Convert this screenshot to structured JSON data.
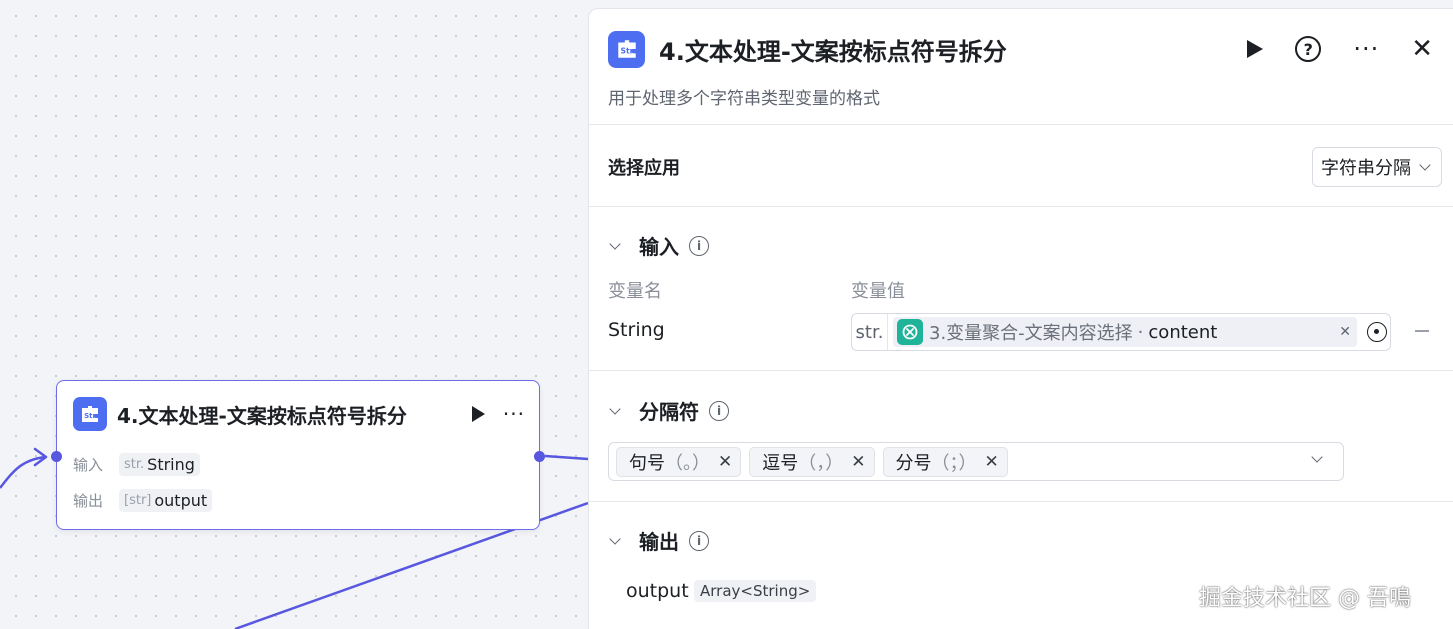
{
  "canvas": {
    "node": {
      "icon": "str-plugin-icon",
      "title": "4.文本处理-文案按标点符号拆分",
      "input_label": "输入",
      "input_type": "str.",
      "input_value": "String",
      "output_label": "输出",
      "output_type": "[str]",
      "output_value": "output"
    }
  },
  "panel": {
    "title": "4.文本处理-文案按标点符号拆分",
    "description": "用于处理多个字符串类型变量的格式",
    "header_icons": [
      "run-icon",
      "help-icon",
      "more-icon",
      "close-icon"
    ],
    "help_glyph": "?",
    "close_glyph": "✕",
    "more_glyph": "···",
    "select_app": {
      "label": "选择应用",
      "value": "字符串分隔"
    },
    "input_section": {
      "title": "输入",
      "col_name": "变量名",
      "col_value": "变量值",
      "row": {
        "name": "String",
        "type": "str.",
        "source": "3.变量聚合-文案内容选择",
        "separator": "·",
        "field": "content",
        "clear": "✕"
      }
    },
    "delimiter_section": {
      "title": "分隔符",
      "tags": [
        {
          "label": "句号",
          "symbol": "（。）"
        },
        {
          "label": "逗号",
          "symbol": "（，）"
        },
        {
          "label": "分号",
          "symbol": "（；）"
        }
      ],
      "remove_glyph": "✕"
    },
    "output_section": {
      "title": "输出",
      "name": "output",
      "type": "Array<String>"
    }
  },
  "watermark": "掘金技术社区 @ 吾鳴",
  "colors": {
    "accent": "#5757e0",
    "app_icon": "#4d6ef1",
    "ref_icon": "#1fb49a"
  }
}
